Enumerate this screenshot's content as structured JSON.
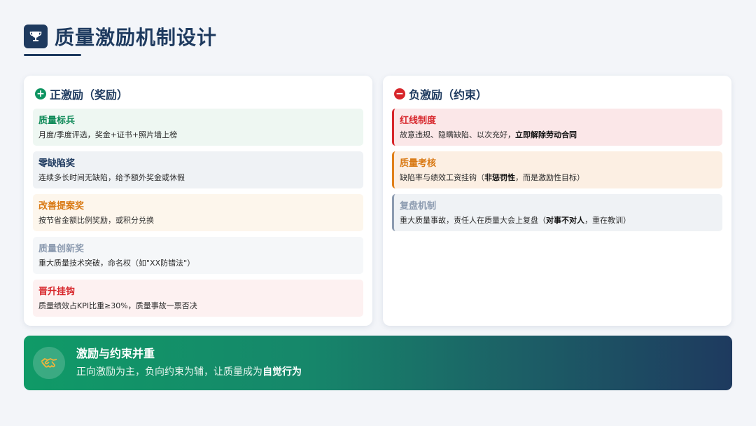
{
  "header": {
    "title": "质量激励机制设计",
    "icon": "trophy-icon"
  },
  "left_card": {
    "icon": "plus-circle-icon",
    "title": "正激励（奖励）",
    "items": [
      {
        "title": "质量标兵",
        "desc": "月度/季度评选，奖金+证书+照片墙上榜"
      },
      {
        "title": "零缺陷奖",
        "desc": "连续多长时间无缺陷，给予额外奖金或休假"
      },
      {
        "title": "改善提案奖",
        "desc": "按节省金额比例奖励，或积分兑换"
      },
      {
        "title": "质量创新奖",
        "desc": "重大质量技术突破，命名权（如\"XX防错法\"）"
      },
      {
        "title": "晋升挂钩",
        "desc": "质量绩效占KPI比重≥30%，质量事故一票否决"
      }
    ]
  },
  "right_card": {
    "icon": "minus-circle-icon",
    "title": "负激励（约束）",
    "items": [
      {
        "title": "红线制度",
        "desc_pre": "故意违规、隐瞒缺陷、以次充好，",
        "desc_bold": "立即解除劳动合同",
        "desc_post": ""
      },
      {
        "title": "质量考核",
        "desc_pre": "缺陷率与绩效工资挂钩（",
        "desc_bold": "非惩罚性",
        "desc_post": "，而是激励性目标）"
      },
      {
        "title": "复盘机制",
        "desc_pre": "重大质量事故，责任人在质量大会上复盘（",
        "desc_bold": "对事不对人",
        "desc_post": "，重在教训）"
      }
    ]
  },
  "banner": {
    "icon": "handshake-icon",
    "title": "激励与约束并重",
    "sub_pre": "正向激励为主，负向约束为辅，让质量成为",
    "sub_bold": "自觉行为"
  },
  "colors": {
    "navy": "#1e3a5f",
    "green": "#0e9461",
    "red": "#d7262b",
    "orange": "#d97a15",
    "grey": "#8c9bb0"
  }
}
